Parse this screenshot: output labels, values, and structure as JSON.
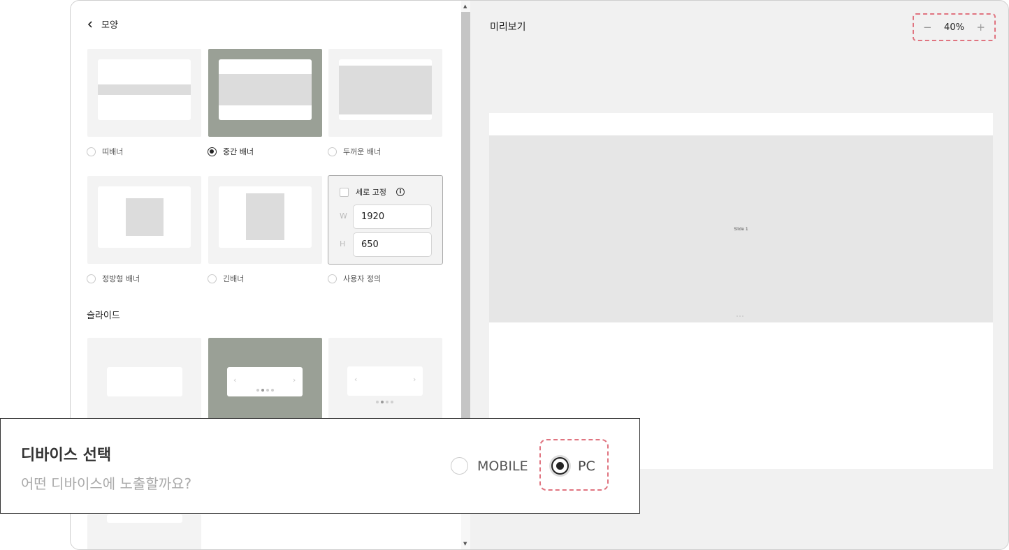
{
  "left_panel": {
    "back_label": "모양",
    "shape_options": [
      {
        "label": "띠배너",
        "selected": false
      },
      {
        "label": "중간 배너",
        "selected": true
      },
      {
        "label": "두꺼운 배너",
        "selected": false
      },
      {
        "label": "정방형 배너",
        "selected": false
      },
      {
        "label": "긴배너",
        "selected": false
      },
      {
        "label": "사용자 정의",
        "selected": false
      }
    ],
    "custom": {
      "fix_height_label": "세로 고정",
      "fix_height_checked": false,
      "width_label": "W",
      "width_value": "1920",
      "height_label": "H",
      "height_value": "650"
    },
    "slide_section_title": "슬라이드"
  },
  "preview": {
    "title": "미리보기",
    "zoom_minus": "−",
    "zoom_value": "40%",
    "zoom_plus": "+",
    "slide_label": "Slide 1"
  },
  "device": {
    "title": "디바이스 선택",
    "subtitle": "어떤 디바이스에 노출할까요?",
    "options": [
      {
        "label": "MOBILE",
        "selected": false
      },
      {
        "label": "PC",
        "selected": true
      }
    ]
  },
  "icons": {
    "support": "headset-icon",
    "chat": "chat-icon"
  },
  "colors": {
    "selected_card": "#9aa096",
    "highlight_dash": "#e07480",
    "fab_accent": "#d6f04a"
  }
}
